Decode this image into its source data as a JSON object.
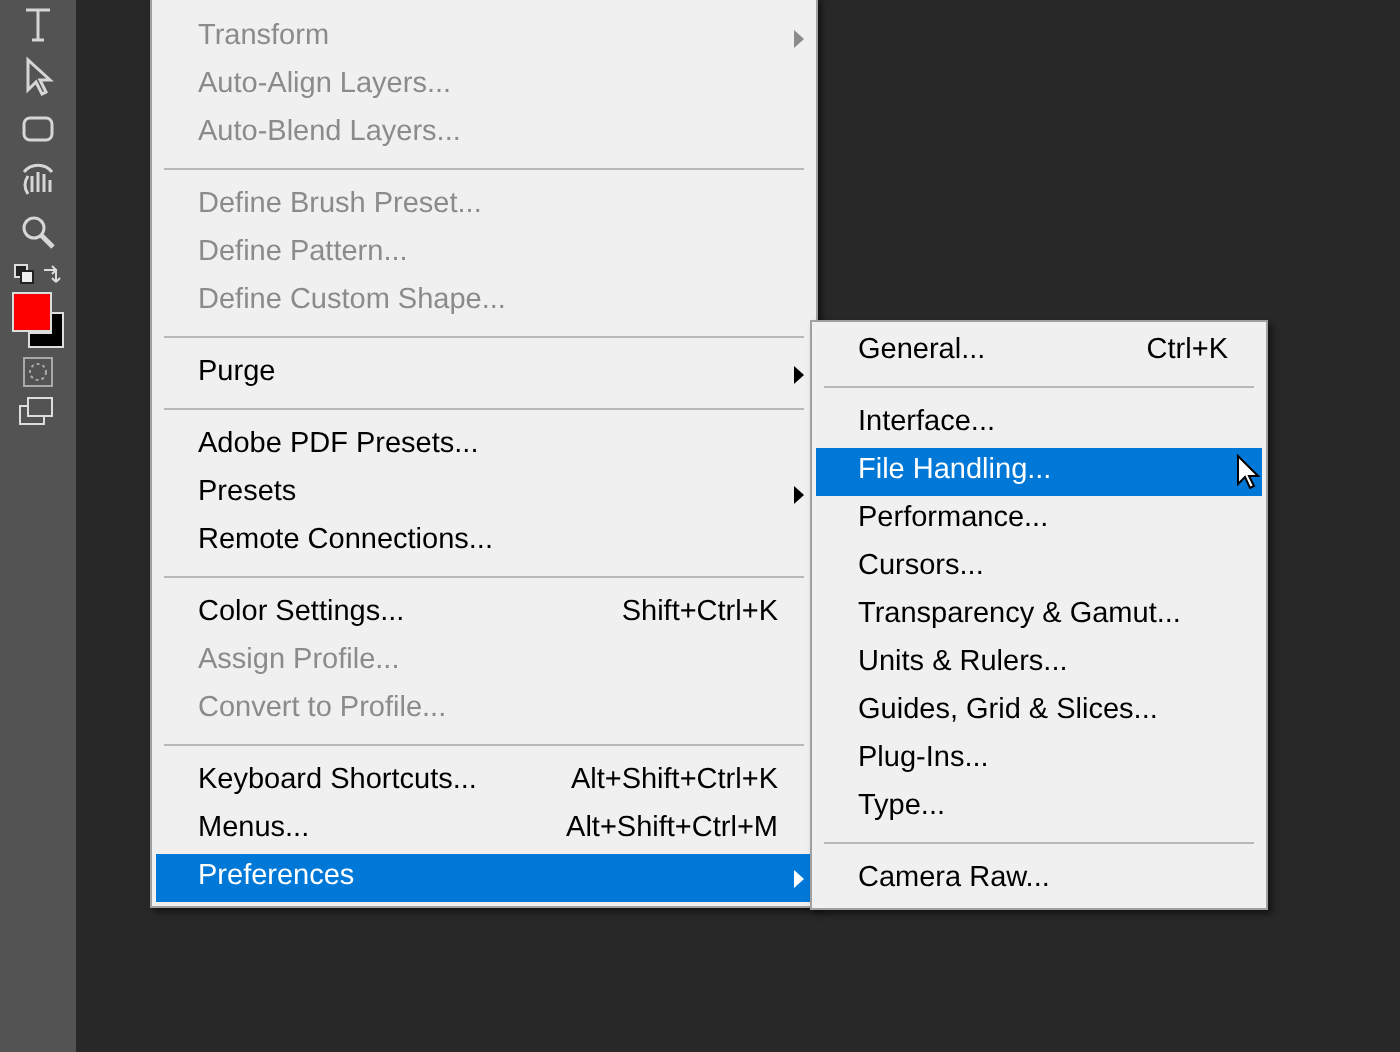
{
  "edit_menu": {
    "items": [
      {
        "kind": "item",
        "label": "Transform",
        "has_submenu": true,
        "disabled": true,
        "selected": false
      },
      {
        "kind": "item",
        "label": "Auto-Align Layers...",
        "disabled": true,
        "selected": false
      },
      {
        "kind": "item",
        "label": "Auto-Blend Layers...",
        "disabled": true,
        "selected": false
      },
      {
        "kind": "separator"
      },
      {
        "kind": "item",
        "label": "Define Brush Preset...",
        "disabled": true,
        "selected": false
      },
      {
        "kind": "item",
        "label": "Define Pattern...",
        "disabled": true,
        "selected": false
      },
      {
        "kind": "item",
        "label": "Define Custom Shape...",
        "disabled": true,
        "selected": false
      },
      {
        "kind": "separator"
      },
      {
        "kind": "item",
        "label": "Purge",
        "has_submenu": true,
        "disabled": false,
        "selected": false
      },
      {
        "kind": "separator"
      },
      {
        "kind": "item",
        "label": "Adobe PDF Presets...",
        "disabled": false,
        "selected": false
      },
      {
        "kind": "item",
        "label": "Presets",
        "has_submenu": true,
        "disabled": false,
        "selected": false
      },
      {
        "kind": "item",
        "label": "Remote Connections...",
        "disabled": false,
        "selected": false
      },
      {
        "kind": "separator"
      },
      {
        "kind": "item",
        "label": "Color Settings...",
        "shortcut": "Shift+Ctrl+K",
        "disabled": false,
        "selected": false
      },
      {
        "kind": "item",
        "label": "Assign Profile...",
        "disabled": true,
        "selected": false
      },
      {
        "kind": "item",
        "label": "Convert to Profile...",
        "disabled": true,
        "selected": false
      },
      {
        "kind": "separator"
      },
      {
        "kind": "item",
        "label": "Keyboard Shortcuts...",
        "shortcut": "Alt+Shift+Ctrl+K",
        "disabled": false,
        "selected": false
      },
      {
        "kind": "item",
        "label": "Menus...",
        "shortcut": "Alt+Shift+Ctrl+M",
        "disabled": false,
        "selected": false
      },
      {
        "kind": "item",
        "label": "Preferences",
        "has_submenu": true,
        "disabled": false,
        "selected": true
      }
    ]
  },
  "preferences_submenu": {
    "items": [
      {
        "kind": "item",
        "label": "General...",
        "shortcut": "Ctrl+K",
        "disabled": false,
        "selected": false
      },
      {
        "kind": "separator"
      },
      {
        "kind": "item",
        "label": "Interface...",
        "disabled": false,
        "selected": false
      },
      {
        "kind": "item",
        "label": "File Handling...",
        "disabled": false,
        "selected": true
      },
      {
        "kind": "item",
        "label": "Performance...",
        "disabled": false,
        "selected": false
      },
      {
        "kind": "item",
        "label": "Cursors...",
        "disabled": false,
        "selected": false
      },
      {
        "kind": "item",
        "label": "Transparency & Gamut...",
        "disabled": false,
        "selected": false
      },
      {
        "kind": "item",
        "label": "Units & Rulers...",
        "disabled": false,
        "selected": false
      },
      {
        "kind": "item",
        "label": "Guides, Grid & Slices...",
        "disabled": false,
        "selected": false
      },
      {
        "kind": "item",
        "label": "Plug-Ins...",
        "disabled": false,
        "selected": false
      },
      {
        "kind": "item",
        "label": "Type...",
        "disabled": false,
        "selected": false
      },
      {
        "kind": "separator"
      },
      {
        "kind": "item",
        "label": "Camera Raw...",
        "disabled": false,
        "selected": false
      }
    ]
  }
}
